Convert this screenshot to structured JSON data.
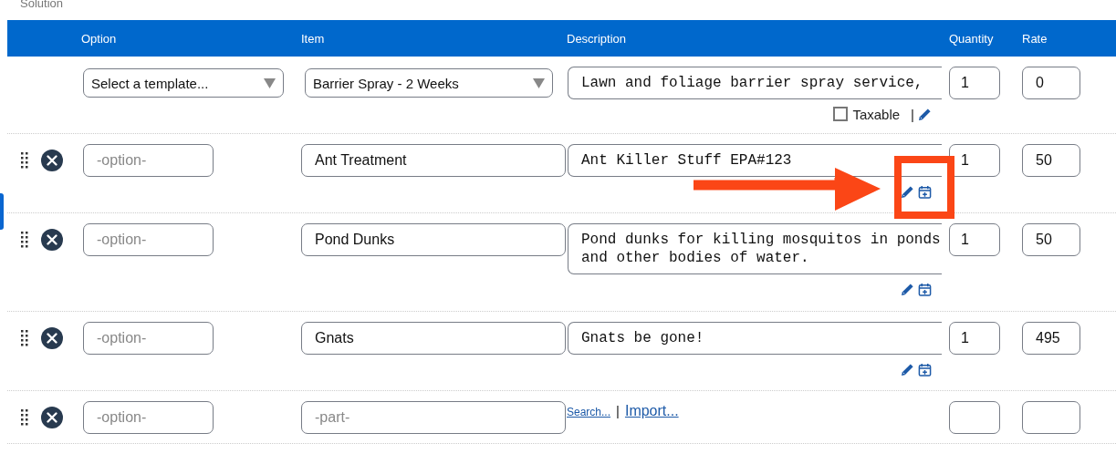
{
  "section_title": "Solution",
  "columns": [
    "Option",
    "Item",
    "Description",
    "Quantity",
    "Rate"
  ],
  "template_row": {
    "option_select": "Select a template...",
    "item_select": "Barrier Spray - 2 Weeks",
    "description": [
      "Lawn and foliage barrier spray service,"
    ],
    "quantity": "1",
    "rate": "0",
    "taxable": {
      "label": "Taxable",
      "checked": false
    },
    "separator": "|"
  },
  "rows": [
    {
      "kind": "item",
      "option_placeholder": "-option-",
      "item": "Ant Treatment",
      "description": [
        "Ant Killer Stuff EPA#123"
      ],
      "quantity": "1",
      "rate": "50",
      "highlighted": true
    },
    {
      "kind": "item",
      "option_placeholder": "-option-",
      "item": "Pond Dunks",
      "description": [
        "Pond dunks for killing mosquitos in ponds",
        "and other bodies of water."
      ],
      "quantity": "1",
      "rate": "50",
      "highlighted": false
    },
    {
      "kind": "item",
      "option_placeholder": "-option-",
      "item": "Gnats",
      "description": [
        "Gnats be gone!"
      ],
      "quantity": "1",
      "rate": "495",
      "highlighted": false
    },
    {
      "kind": "new",
      "option_placeholder": "-option-",
      "item_placeholder": "-part-",
      "links": [
        "Search...",
        "Import..."
      ],
      "link_separator": "|",
      "highlighted": false
    }
  ]
}
